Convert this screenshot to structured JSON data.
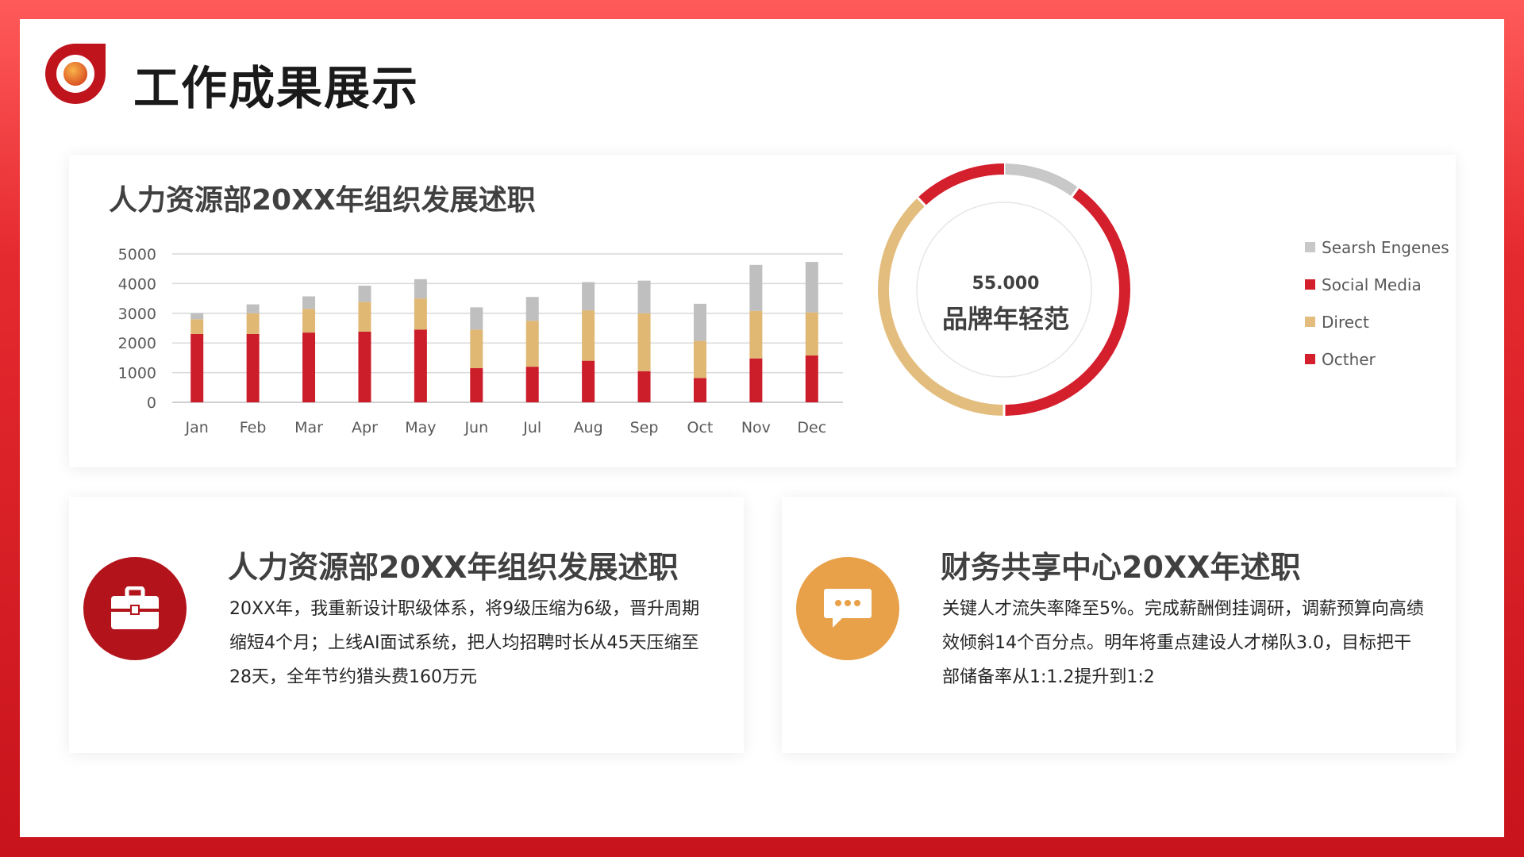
{
  "page": {
    "title": "工作成果展示"
  },
  "colors": {
    "frame_red": "#d9252f",
    "bar_red": "#cc1d2a",
    "bar_tan": "#e0b874",
    "bar_gray": "#bfbfbf",
    "icon_red": "#b3141c",
    "icon_orange": "#e8a049"
  },
  "chart_section": {
    "title": "人力资源部20XX年组织发展述职",
    "donut_value": "55.000",
    "donut_label": "品牌年轻范"
  },
  "chart_data": [
    {
      "type": "bar",
      "stacked": true,
      "categories": [
        "Jan",
        "Feb",
        "Mar",
        "Apr",
        "May",
        "Jun",
        "Jul",
        "Aug",
        "Sep",
        "Oct",
        "Nov",
        "Dec"
      ],
      "series": [
        {
          "name": "",
          "color": "#cc1d2a",
          "values": [
            2300,
            2300,
            2350,
            2380,
            2450,
            1150,
            1200,
            1400,
            1050,
            820,
            1480,
            1580
          ]
        },
        {
          "name": "",
          "color": "#e0b874",
          "values": [
            500,
            700,
            800,
            1000,
            1050,
            1300,
            1550,
            1700,
            1950,
            1250,
            1600,
            1450
          ]
        },
        {
          "name": "",
          "color": "#bfbfbf",
          "values": [
            200,
            300,
            420,
            550,
            650,
            750,
            800,
            950,
            1100,
            1250,
            1550,
            1700
          ]
        }
      ],
      "ylim": [
        0,
        5000
      ],
      "yticks": [
        0,
        1000,
        2000,
        3000,
        4000,
        5000
      ],
      "grid": true,
      "legend": "none"
    },
    {
      "type": "pie",
      "style": "donut",
      "labels": [
        "Searsh Engenes",
        "Social Media",
        "Direct",
        "Octher"
      ],
      "colors": [
        "#c8c8c8",
        "#d41f2d",
        "#e3bd7d",
        "#d41f2d"
      ],
      "values": [
        10,
        40,
        38,
        12
      ],
      "legend": "right"
    }
  ],
  "legend": [
    {
      "label": "Searsh Engenes",
      "color": "#c8c8c8"
    },
    {
      "label": "Social Media",
      "color": "#d41f2d"
    },
    {
      "label": "Direct",
      "color": "#e3bd7d"
    },
    {
      "label": "Octher",
      "color": "#d41f2d"
    }
  ],
  "cards": [
    {
      "icon": "briefcase-icon",
      "title": "人力资源部20XX年组织发展述职",
      "body": "20XX年，我重新设计职级体系，将9级压缩为6级，晋升周期缩短4个月；上线AI面试系统，把人均招聘时长从45天压缩至28天，全年节约猎头费160万元"
    },
    {
      "icon": "chat-bubble-icon",
      "title": "财务共享中心20XX年述职",
      "body": "关键人才流失率降至5%。完成薪酬倒挂调研，调薪预算向高绩效倾斜14个百分点。明年将重点建设人才梯队3.0，目标把干部储备率从1:1.2提升到1:2"
    }
  ]
}
